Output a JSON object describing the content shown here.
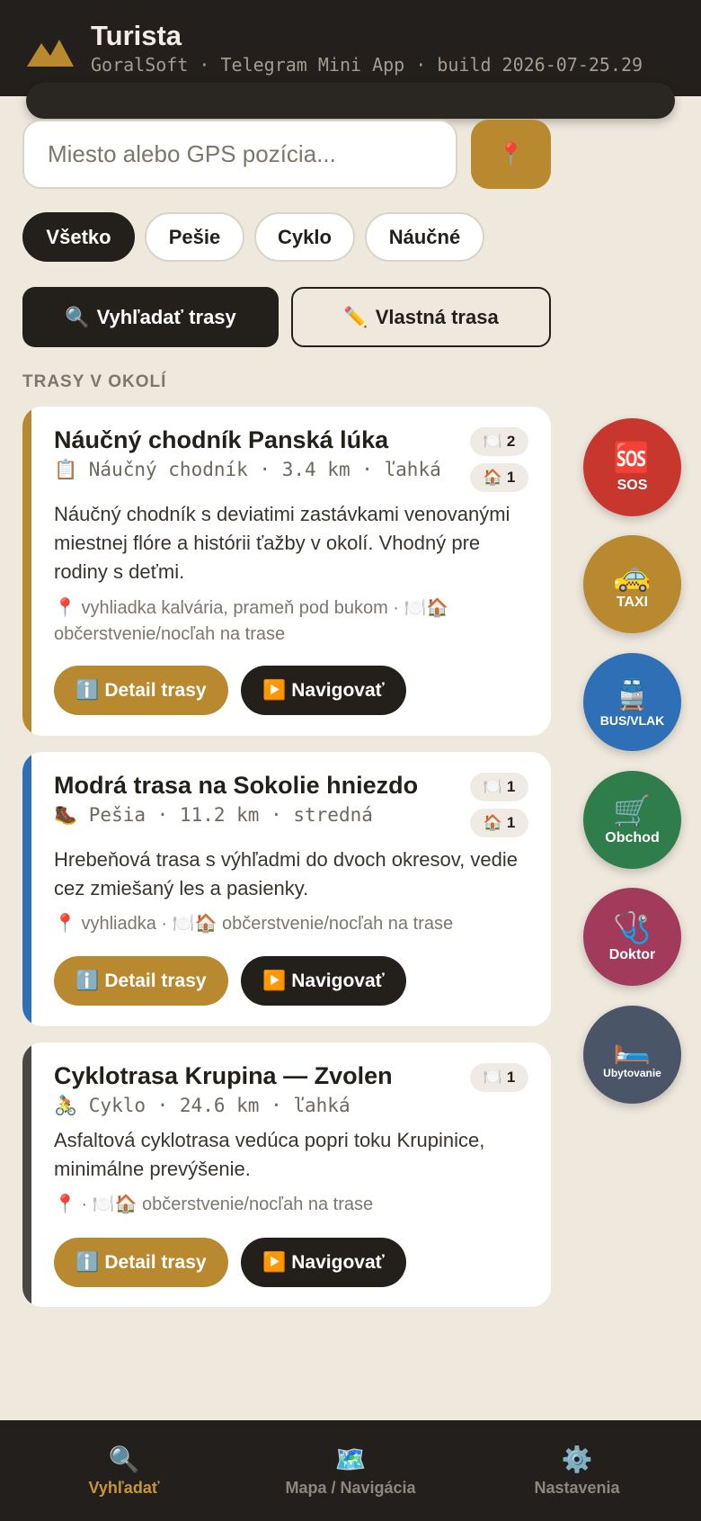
{
  "app": {
    "title": "Turista",
    "subtitle": "GoralSoft · Telegram Mini App · build 2026-07-25.29",
    "logo_icon": "mountain-logo"
  },
  "search": {
    "placeholder": "Miesto alebo GPS pozícia...",
    "gps_icon": "📍"
  },
  "filters": [
    {
      "label": "Všetko",
      "active": true
    },
    {
      "label": "Pešie",
      "active": false
    },
    {
      "label": "Cyklo",
      "active": false
    },
    {
      "label": "Náučné",
      "active": false
    }
  ],
  "actions": {
    "search_icon": "🔍",
    "search_label": "Vyhľadať trasy",
    "custom_icon": "✏️",
    "custom_label": "Vlastná trasa"
  },
  "section_title": "TRASY V OKOLÍ",
  "routes": [
    {
      "title": "Náučný chodník Panská lúka",
      "meta": "📋 Náučný chodník · 3.4 km · ľahká",
      "accent": "#b8892e",
      "badges": [
        {
          "icon": "🍽️",
          "count": "2"
        },
        {
          "icon": "🏠",
          "count": "1"
        }
      ],
      "description": "Náučný chodník s deviatimi zastávkami venovanými miestnej flóre a histórii ťažby v okolí. Vhodný pre rodiny s deťmi.",
      "poi": "📍 vyhliadka kalvária, prameň pod bukom · 🍽️🏠 občerstvenie/nocľah na trase",
      "detail_label": "ℹ️ Detail trasy",
      "nav_label": "▶️ Navigovať"
    },
    {
      "title": "Modrá trasa na Sokolie hniezdo",
      "meta": "🥾 Pešia · 11.2 km · stredná",
      "accent": "#2f6fb5",
      "badges": [
        {
          "icon": "🍽️",
          "count": "1"
        },
        {
          "icon": "🏠",
          "count": "1"
        }
      ],
      "description": "Hrebeňová trasa s výhľadmi do dvoch okresov, vedie cez zmiešaný les a pasienky.",
      "poi": "📍 vyhliadka · 🍽️🏠 občerstvenie/nocľah na trase",
      "detail_label": "ℹ️ Detail trasy",
      "nav_label": "▶️ Navigovať"
    },
    {
      "title": "Cyklotrasa Krupina — Zvolen",
      "meta": "🚴 Cyklo · 24.6 km · ľahká",
      "accent": "#4a4744",
      "badges": [
        {
          "icon": "🍽️",
          "count": "1"
        }
      ],
      "description": "Asfaltová cyklotrasa vedúca popri toku Krupinice, minimálne prevýšenie.",
      "poi": "📍 · 🍽️🏠 občerstvenie/nocľah na trase",
      "detail_label": "ℹ️ Detail trasy",
      "nav_label": "▶️ Navigovať"
    }
  ],
  "fabs": [
    {
      "icon": "🆘",
      "label": "SOS",
      "color": "#c8372d"
    },
    {
      "icon": "🚕",
      "label": "TAXI",
      "color": "#b8892e"
    },
    {
      "icon": "🚆",
      "label": "BUS/VLAK",
      "color": "#2f6fb5"
    },
    {
      "icon": "🛒",
      "label": "Obchod",
      "color": "#2e7d4a"
    },
    {
      "icon": "🩺",
      "label": "Doktor",
      "color": "#a23a5c"
    },
    {
      "icon": "🛏️",
      "label": "Ubytovanie",
      "color": "#4a5568"
    }
  ],
  "bottom_nav": [
    {
      "icon": "🔍",
      "label": "Vyhľadať",
      "active": true
    },
    {
      "icon": "🗺️",
      "label": "Mapa / Navigácia",
      "active": false
    },
    {
      "icon": "⚙️",
      "label": "Nastavenia",
      "active": false
    }
  ],
  "colors": {
    "background": "#efe8dd",
    "header": "#221f1c",
    "accent_gold": "#b8892e",
    "dark": "#231f1b"
  }
}
